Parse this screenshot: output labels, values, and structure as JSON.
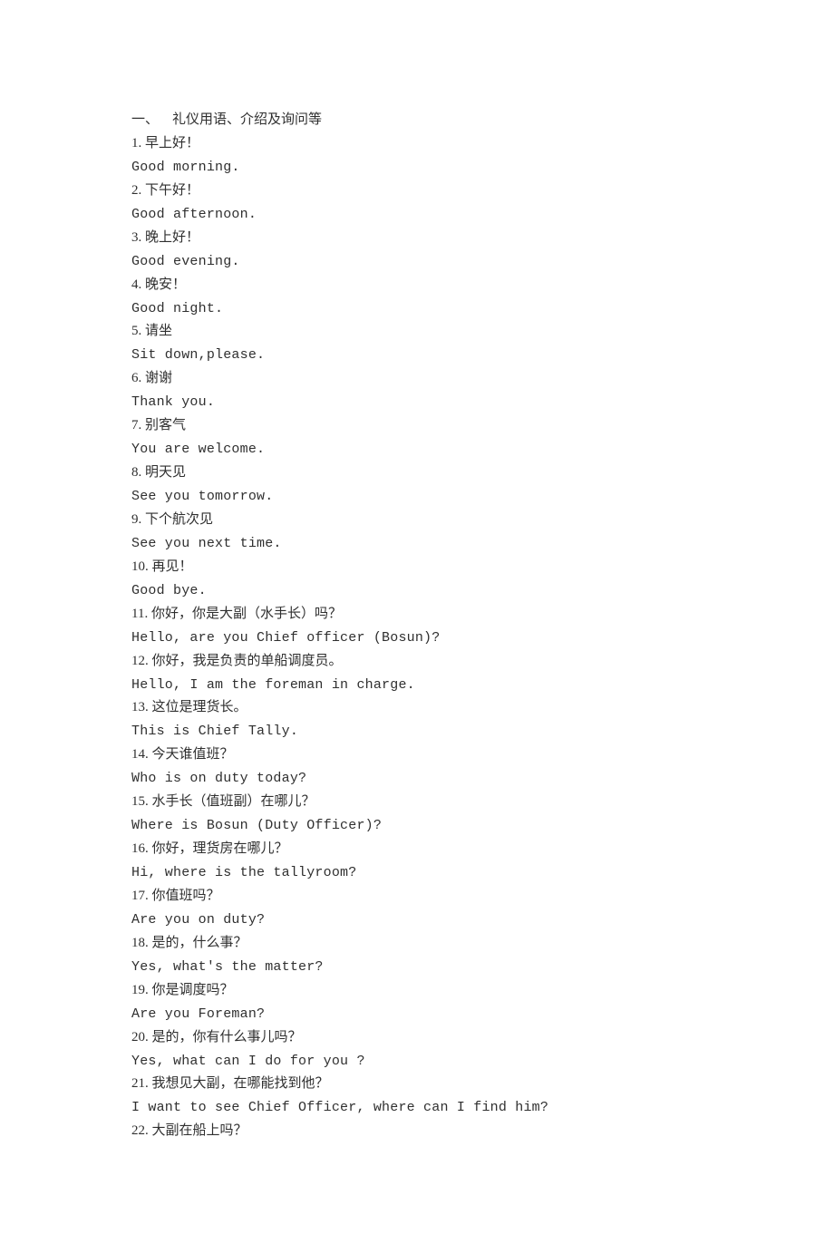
{
  "section": {
    "heading": "一、    礼仪用语、介绍及询问等",
    "items": [
      {
        "num": "1.",
        "zh": "早上好！",
        "en": "Good morning."
      },
      {
        "num": "2.",
        "zh": "下午好！",
        "en": "Good afternoon."
      },
      {
        "num": "3.",
        "zh": "晚上好！",
        "en": "Good evening."
      },
      {
        "num": "4.",
        "zh": "晚安！",
        "en": "Good night."
      },
      {
        "num": "5.",
        "zh": "请坐",
        "en": "Sit down,please."
      },
      {
        "num": "6.",
        "zh": "谢谢",
        "en": "Thank you."
      },
      {
        "num": "7.",
        "zh": "别客气",
        "en": "You are welcome."
      },
      {
        "num": "8.",
        "zh": "明天见",
        "en": "See you tomorrow."
      },
      {
        "num": "9.",
        "zh": "下个航次见",
        "en": "See you next time."
      },
      {
        "num": "10.",
        "zh": "再见！",
        "en": "Good bye."
      },
      {
        "num": "11.",
        "zh": "你好，你是大副（水手长）吗？",
        "en": "Hello, are you Chief officer (Bosun)?"
      },
      {
        "num": "12.",
        "zh": "你好，我是负责的单船调度员。",
        "en": "Hello, I am the foreman in charge."
      },
      {
        "num": "13.",
        "zh": "这位是理货长。",
        "en": "This is Chief Tally."
      },
      {
        "num": "14.",
        "zh": "今天谁值班？",
        "en": "Who is on duty today?"
      },
      {
        "num": "15.",
        "zh": "水手长（值班副）在哪儿？",
        "en": "Where is Bosun (Duty Officer)?"
      },
      {
        "num": "16.",
        "zh": "你好，理货房在哪儿？",
        "en": "Hi, where is the tallyroom?"
      },
      {
        "num": "17.",
        "zh": "你值班吗？",
        "en": "Are you on duty?"
      },
      {
        "num": "18.",
        "zh": "是的，什么事？",
        "en": "Yes, what's the matter?"
      },
      {
        "num": "19.",
        "zh": "你是调度吗？",
        "en": "Are you Foreman?"
      },
      {
        "num": "20.",
        "zh": "是的，你有什么事儿吗？",
        "en": "Yes, what can I do for you ?"
      },
      {
        "num": "21.",
        "zh": "我想见大副，在哪能找到他？",
        "en": "I want to see Chief Officer, where can I find him?"
      },
      {
        "num": "22.",
        "zh": "大副在船上吗？",
        "en": ""
      }
    ]
  }
}
